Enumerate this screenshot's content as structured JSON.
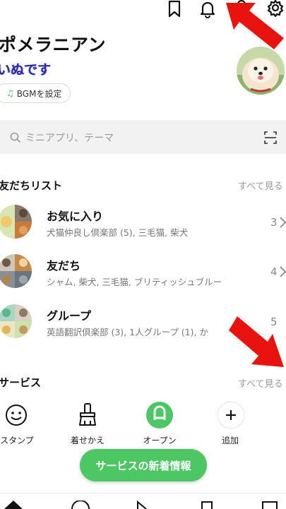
{
  "profile": {
    "name": "ポメラニアン",
    "status": "いぬです",
    "bgm_label": "BGMを設定"
  },
  "header_icons": [
    "bookmark-icon",
    "bell-icon",
    "add-friend-icon",
    "gear-icon"
  ],
  "search": {
    "placeholder": "ミニアプリ、テーマ"
  },
  "friends_section": {
    "title": "友だちリスト",
    "see_all": "すべて見る",
    "rows": [
      {
        "title": "お気に入り",
        "subtitle": "犬猫仲良し倶楽部 (5), 三毛猫, 柴犬",
        "count": "3"
      },
      {
        "title": "友だち",
        "subtitle": "シャム, 柴犬, 三毛猫, ブリティッシュブルー",
        "count": "4"
      },
      {
        "title": "グループ",
        "subtitle": "英語翻訳倶楽部 (3), 1人グループ (1), か",
        "count": "5"
      }
    ]
  },
  "services_section": {
    "title": "サービス",
    "see_all": "すべて見る",
    "items": [
      {
        "label": "スタンプ",
        "icon": "smiley-icon"
      },
      {
        "label": "着せかえ",
        "icon": "brush-icon"
      },
      {
        "label": "オープン",
        "icon": "openchat-icon"
      },
      {
        "label": "追加",
        "icon": "plus-icon"
      }
    ]
  },
  "news_button": "サービスの新着情報",
  "colors": {
    "accent": "#4cc764",
    "annotation_arrow": "#e8130e"
  }
}
